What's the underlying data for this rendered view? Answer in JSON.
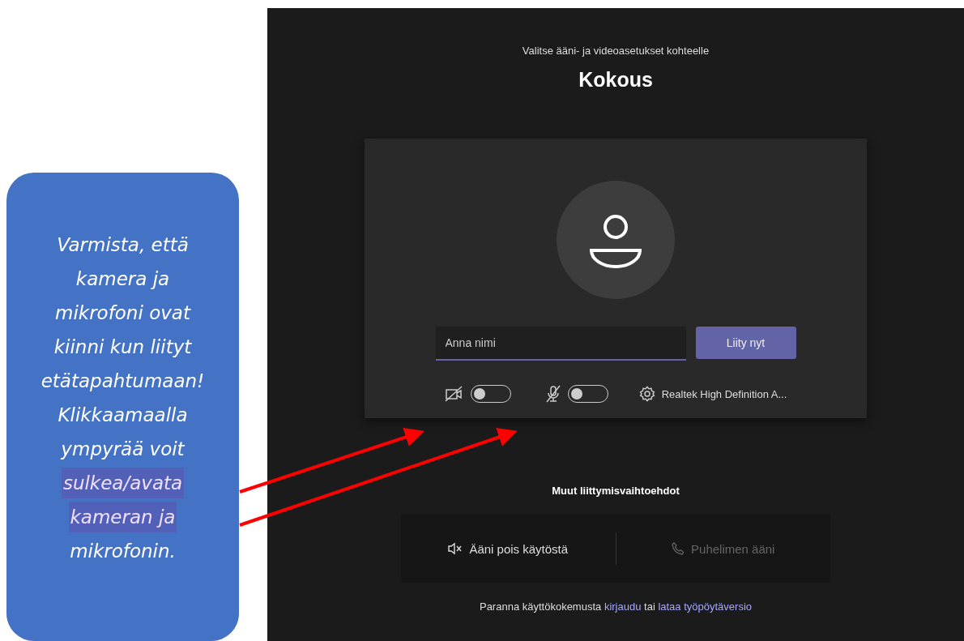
{
  "callout": {
    "lines": [
      {
        "text": "Varmista, että",
        "highlighted": false
      },
      {
        "text": "kamera ja",
        "highlighted": false
      },
      {
        "text": "mikrofoni ovat",
        "highlighted": false
      },
      {
        "text": "kiinni kun liityt",
        "highlighted": false
      },
      {
        "text": "etätapahtumaan!",
        "highlighted": false
      },
      {
        "text": "Klikkaamaalla",
        "highlighted": false
      },
      {
        "text": "ympyrää voit",
        "highlighted": false
      },
      {
        "text": "sulkea/avata",
        "highlighted": true
      },
      {
        "text": "kameran ja",
        "highlighted": true
      },
      {
        "text": "mikrofonin.",
        "highlighted": false
      }
    ]
  },
  "join": {
    "subtitle": "Valitse ääni- ja videoasetukset kohteelle",
    "title": "Kokous",
    "name_field": {
      "placeholder": "Anna nimi"
    },
    "join_button": "Liity nyt",
    "camera": {
      "on": false
    },
    "microphone": {
      "on": false
    },
    "device": "Realtek High Definition A..."
  },
  "other_options": {
    "heading": "Muut liittymisvaihtoehdot",
    "options": [
      {
        "label": "Ääni pois käytöstä",
        "disabled": false
      },
      {
        "label": "Puhelimen ääni",
        "disabled": true
      }
    ]
  },
  "footer": {
    "text": "Paranna käyttökokemusta",
    "links": [
      "kirjaudu",
      "lataa työpöytäversio"
    ],
    "joiner": "tai"
  }
}
